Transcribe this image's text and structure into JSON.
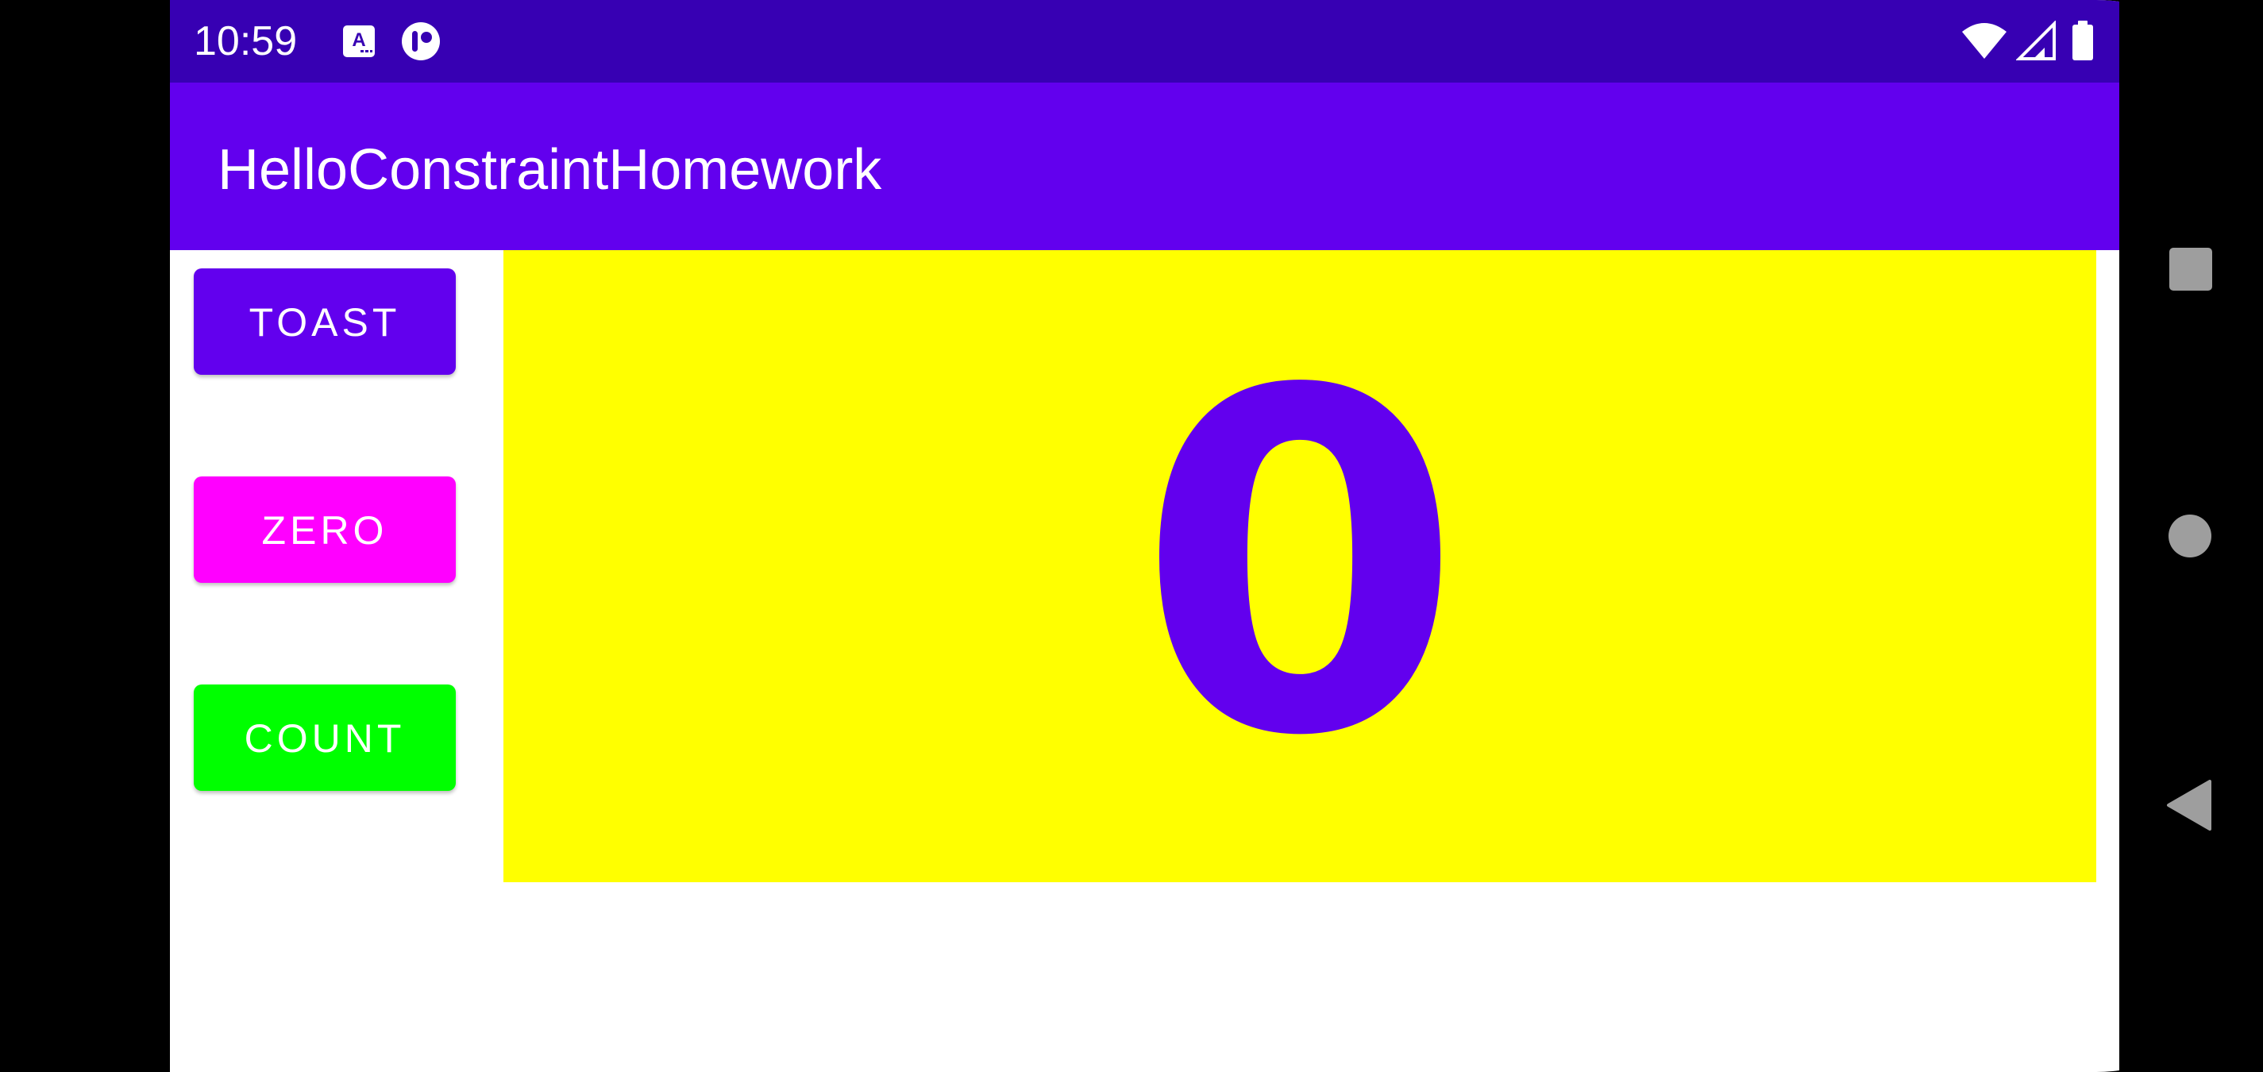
{
  "status_bar": {
    "time": "10:59",
    "icons": [
      "accessibility-text-icon",
      "app-notification-icon",
      "wifi-icon",
      "signal-icon",
      "battery-icon"
    ]
  },
  "app_bar": {
    "title": "HelloConstraintHomework"
  },
  "buttons": {
    "toast": "TOAST",
    "zero": "ZERO",
    "count": "COUNT"
  },
  "counter": {
    "value": "0"
  },
  "nav_bar": {
    "icons": [
      "recents-square-icon",
      "home-circle-icon",
      "back-triangle-icon"
    ]
  },
  "colors": {
    "status_bar": "#3700b3",
    "app_bar": "#6200ee",
    "toast_button": "#6200ee",
    "zero_button": "#ff00ff",
    "count_button": "#00ff00",
    "count_background": "#ffff00",
    "count_text": "#6200ee",
    "nav_icons": "#9e9e9e"
  }
}
